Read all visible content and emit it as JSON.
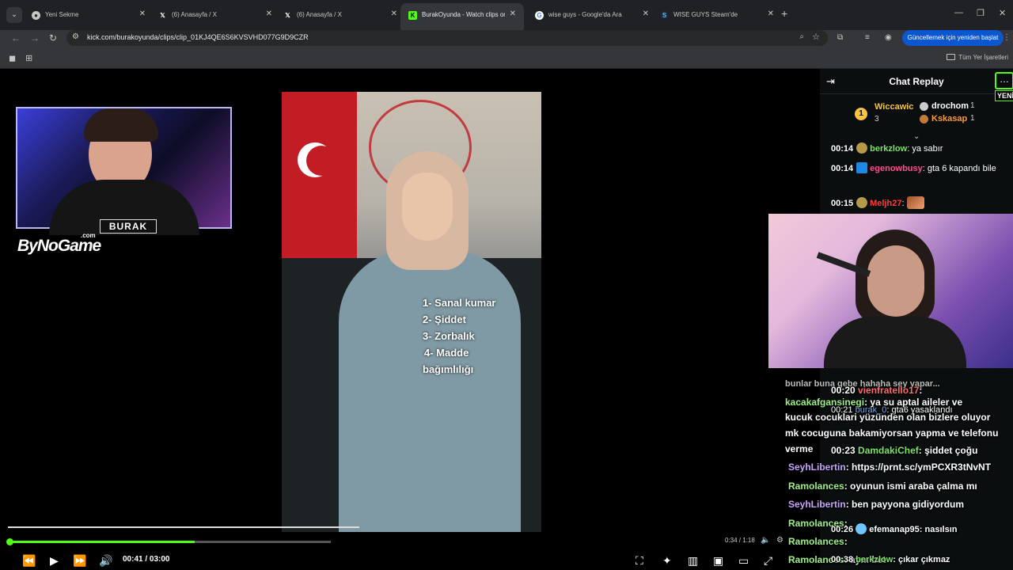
{
  "browser": {
    "tabs": [
      {
        "label": "Yeni Sekme",
        "icon": "chrome-icon"
      },
      {
        "label": "(6) Anasayfa / X",
        "icon": "x-icon"
      },
      {
        "label": "(6) Anasayfa / X",
        "icon": "x-icon"
      },
      {
        "label": "BurakOyunda - Watch clips on K",
        "icon": "kick-icon",
        "active": true
      },
      {
        "label": "wise guys - Google'da Ara",
        "icon": "google-icon"
      },
      {
        "label": "WISE GUYS Steam'de",
        "icon": "steam-icon"
      }
    ],
    "url": "kick.com/burakoyunda/clips/clip_01KJ4QE6S6KVSVHD077G9D9CZR",
    "update_label": "Güncellemek için yeniden başlat",
    "bookmarks_all": "Tüm Yer İşaretleri"
  },
  "player": {
    "overlay_brand": "BURAK",
    "overlay_logo": "ByNoGame",
    "overlay_logo_sub": ".com",
    "list_items": [
      "1- Sanal kumar",
      "2- Şiddet",
      "3- Zorbalık",
      "4- Madde",
      "bağımlılığı"
    ],
    "inner_time": "0:34 / 1:18",
    "current_time": "00:41",
    "separator": "/",
    "total_time": "03:00",
    "progress_fraction": 0.23,
    "inner_progress_fraction": 0.44,
    "accent": "#53fc18"
  },
  "chat": {
    "title": "Chat Replay",
    "new_badge": "YENİ",
    "leaderboard": [
      {
        "rank": "1",
        "name": "Wiccawic",
        "count": "3",
        "color": "#f5c542"
      },
      {
        "rank": "2",
        "name": "drochom",
        "count": "1",
        "color": "#ffffff"
      },
      {
        "rank": "3",
        "name": "Kskasap",
        "count": "1",
        "color": "#f59a42"
      }
    ],
    "messages": [
      {
        "time": "00:14",
        "user": "berkzlow",
        "user_color": "#7ee36a",
        "text": ": ya sabır"
      },
      {
        "time": "00:14",
        "user": "egenowbusy",
        "user_color": "#ff4f8b",
        "text": ": gta 6 kapandı bile"
      },
      {
        "time": "00:15",
        "user": "Meljh27",
        "user_color": "#ff3b3b",
        "text": ":"
      }
    ]
  },
  "overlay_chat": [
    {
      "user": "",
      "text": "bunlar buna gebe hahaha sey yapar..."
    },
    {
      "time": "00:20",
      "user": "vienfratello17",
      "text": ":"
    },
    {
      "user": "kacakafgansinegi",
      "text": ": ya su aptal aileler ve"
    },
    {
      "time": "00:21",
      "user": "burak_0",
      "text": ": gta6 yasaklandı"
    },
    {
      "text": "kucuk cocuklari yüzünden olan bizlere oluyor"
    },
    {
      "text": "mk cocuguna bakamiyorsan yapma ve telefonu"
    },
    {
      "time": "00:23",
      "user": "DamdakiChef",
      "text": ": şiddet çoğu"
    },
    {
      "text": "verme"
    },
    {
      "user": "SeyhLibertin",
      "text": ": https://prnt.sc/ymPCXR3tNvNT"
    },
    {
      "user": "Ramolances",
      "text": ": oyunun ismi araba çalma mı"
    },
    {
      "user": "SeyhLibertin",
      "text": ": ben payyona gidiyordum"
    },
    {
      "user": "Ramolances",
      "text": ":"
    },
    {
      "time": "00:26",
      "user": "efemanap95",
      "text": ": nasılsın"
    },
    {
      "user": "Ramolances",
      "text": ":"
    },
    {
      "user": "Ramolances",
      "text": ": aynı bet"
    },
    {
      "time": "00:38",
      "user": "berkzlow",
      "text": ": çıkar çıkmaz"
    }
  ]
}
